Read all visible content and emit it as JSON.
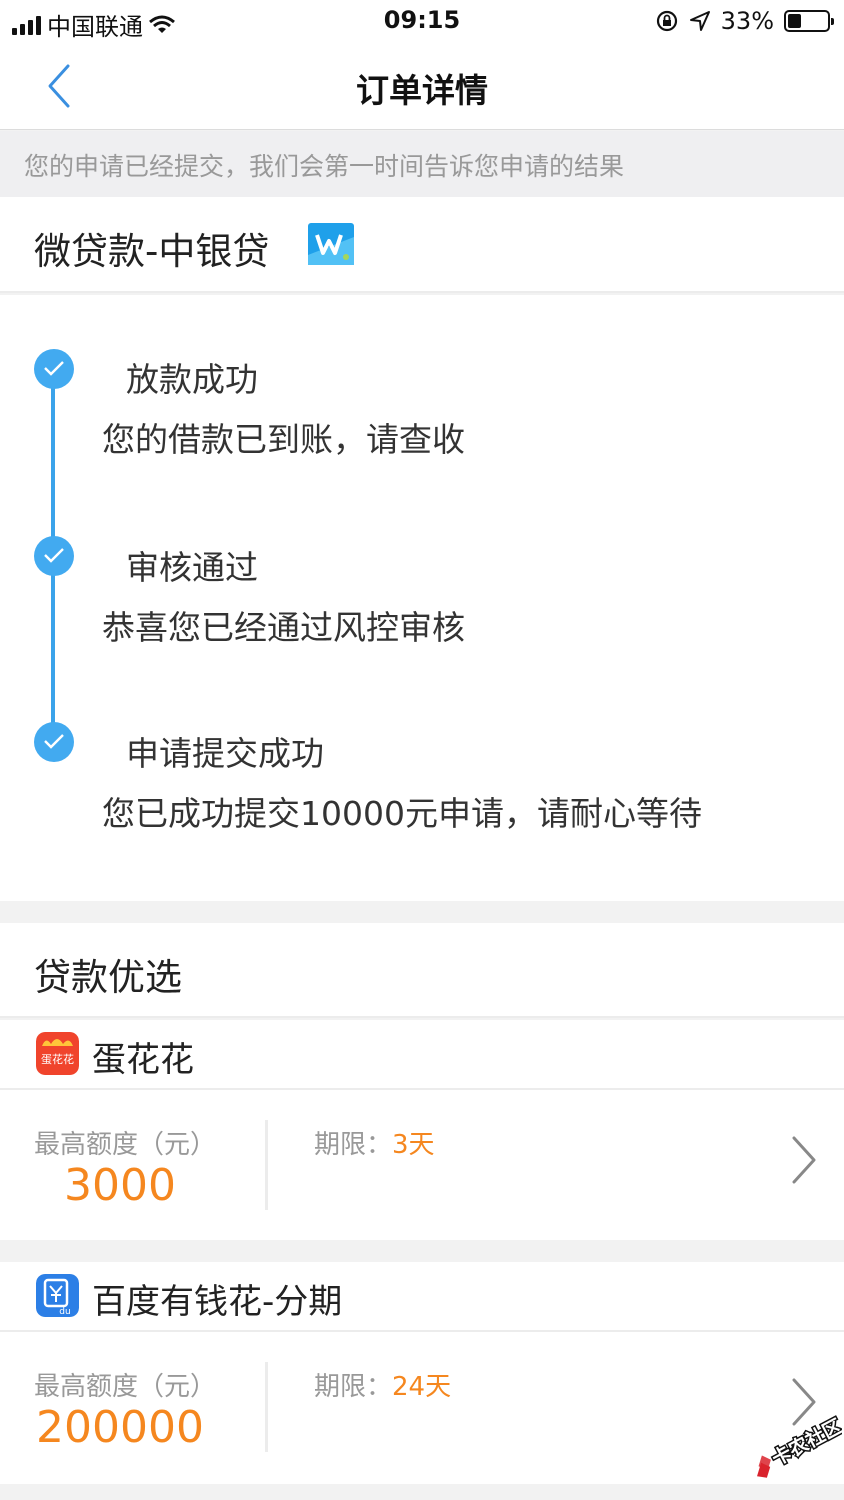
{
  "status_bar": {
    "carrier": "中国联通",
    "time": "09:15",
    "battery": "33%",
    "battery_level": 0.33
  },
  "nav": {
    "title": "订单详情"
  },
  "notice": "您的申请已经提交，我们会第一时间告诉您申请的结果",
  "product": {
    "name": "微贷款-中银贷"
  },
  "timeline": [
    {
      "title": "放款成功",
      "desc": "您的借款已到账，请查收"
    },
    {
      "title": "审核通过",
      "desc": "恭喜您已经通过风控审核"
    },
    {
      "title": "申请提交成功",
      "desc": "您已成功提交10000元申请，请耐心等待"
    }
  ],
  "recommend": {
    "title": "贷款优选",
    "items": [
      {
        "name": "蛋花花",
        "icon_text": "蛋花花",
        "amount_label": "最高额度（元）",
        "amount": "3000",
        "term_label": "期限：",
        "term": "3天"
      },
      {
        "name": "百度有钱花-分期",
        "icon_text": "du",
        "amount_label": "最高额度（元）",
        "amount": "200000",
        "term_label": "期限：",
        "term": "24天"
      }
    ]
  },
  "watermark": "卡农社区",
  "colors": {
    "accent_blue": "#42aaf0",
    "amount_orange": "#f5871f",
    "secondary_text": "#999999"
  }
}
